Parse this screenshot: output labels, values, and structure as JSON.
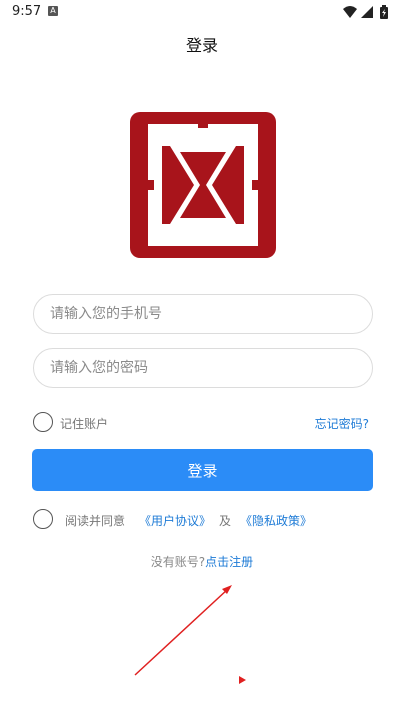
{
  "status": {
    "time": "9:57",
    "badge": "A"
  },
  "header": {
    "title": "登录"
  },
  "form": {
    "phone_placeholder": "请输入您的手机号",
    "password_placeholder": "请输入您的密码",
    "remember_label": "记住账户",
    "forgot_label": "忘记密码?",
    "login_label": "登录",
    "agree_prefix": "阅读并同意",
    "terms_label": "《用户协议》",
    "and_label": "及",
    "privacy_label": "《隐私政策》",
    "no_account_text": "没有账号?",
    "register_label": "点击注册"
  },
  "colors": {
    "brand_red": "#a8141b",
    "primary_blue": "#2b8cf7",
    "link_blue": "#1e7bd6",
    "annotation_red": "#e02020"
  }
}
